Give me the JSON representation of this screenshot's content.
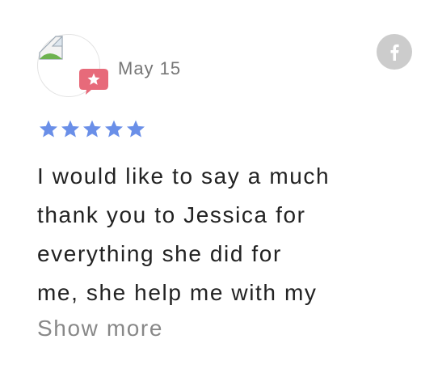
{
  "review": {
    "date": "May 15",
    "rating": 5,
    "rating_max": 5,
    "lines": [
      "I would like to say a much",
      "thank you to Jessica for",
      "everything she did for",
      "me, she help me with my"
    ],
    "show_more_label": "Show more"
  },
  "icons": {
    "avatar": "broken-image-icon",
    "badge": "star-badge-icon",
    "share": "facebook-icon",
    "rating": "star-icon"
  },
  "colors": {
    "star": "#6a8fe8",
    "badge": "#e76a7a",
    "facebook_button": "#cccccc",
    "date_text": "#777777",
    "body_text": "#222222",
    "show_more_text": "#888888"
  }
}
